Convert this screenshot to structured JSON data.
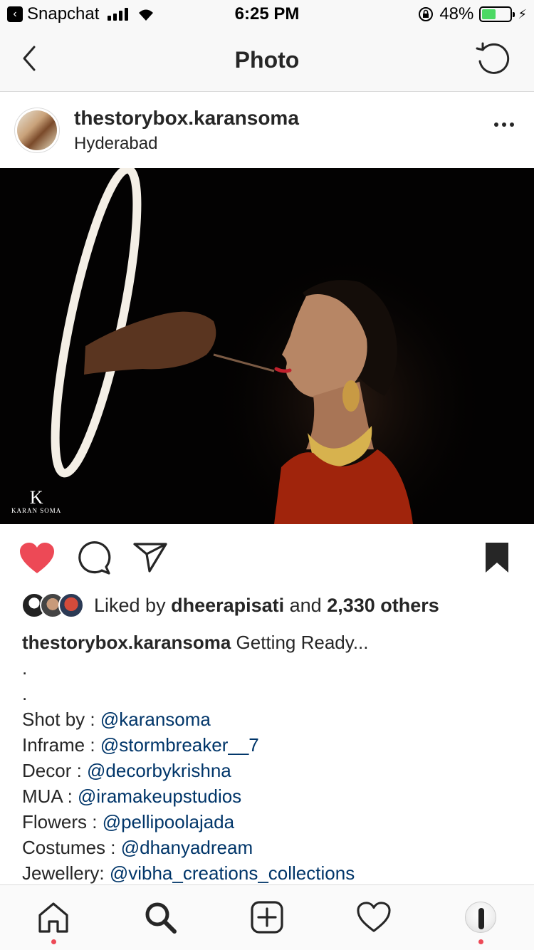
{
  "status_bar": {
    "back_app_label": "Snapchat",
    "time": "6:25 PM",
    "battery_percent_label": "48%",
    "battery_level": 0.48,
    "battery_color": "#4cd964"
  },
  "nav": {
    "title": "Photo",
    "back_icon": "chevron-left-icon",
    "refresh_icon": "refresh-icon"
  },
  "post": {
    "username": "thestorybox.karansoma",
    "location": "Hyderabad",
    "watermark_initial": "K",
    "watermark_text": "KARAN SOMA"
  },
  "actions": {
    "liked": true,
    "like_color": "#ed4956",
    "saved": true
  },
  "likes": {
    "prefix": "Liked by ",
    "user": "dheerapisati",
    "middle": " and ",
    "count": "2,330 others"
  },
  "caption": {
    "username": "thestorybox.karansoma",
    "text": " Getting Ready...",
    "dot_lines": [
      ".",
      "."
    ],
    "credits": [
      {
        "label": "Shot by : ",
        "mention": "@karansoma"
      },
      {
        "label": "Inframe : ",
        "mention": "@stormbreaker__7"
      },
      {
        "label": "Decor : ",
        "mention": "@decorbykrishna"
      },
      {
        "label": "MUA : ",
        "mention": "@iramakeupstudios"
      },
      {
        "label": "Flowers : ",
        "mention": "@pellipoolajada"
      },
      {
        "label": "Costumes : ",
        "mention": "@dhanyadream"
      },
      {
        "label": "Jewellery: ",
        "mention": "@vibha_creations_collections"
      }
    ]
  },
  "tab_bar": {
    "items": [
      "home-icon",
      "search-icon",
      "new-post-icon",
      "activity-icon",
      "profile-avatar"
    ],
    "notification_color": "#ed4956"
  }
}
